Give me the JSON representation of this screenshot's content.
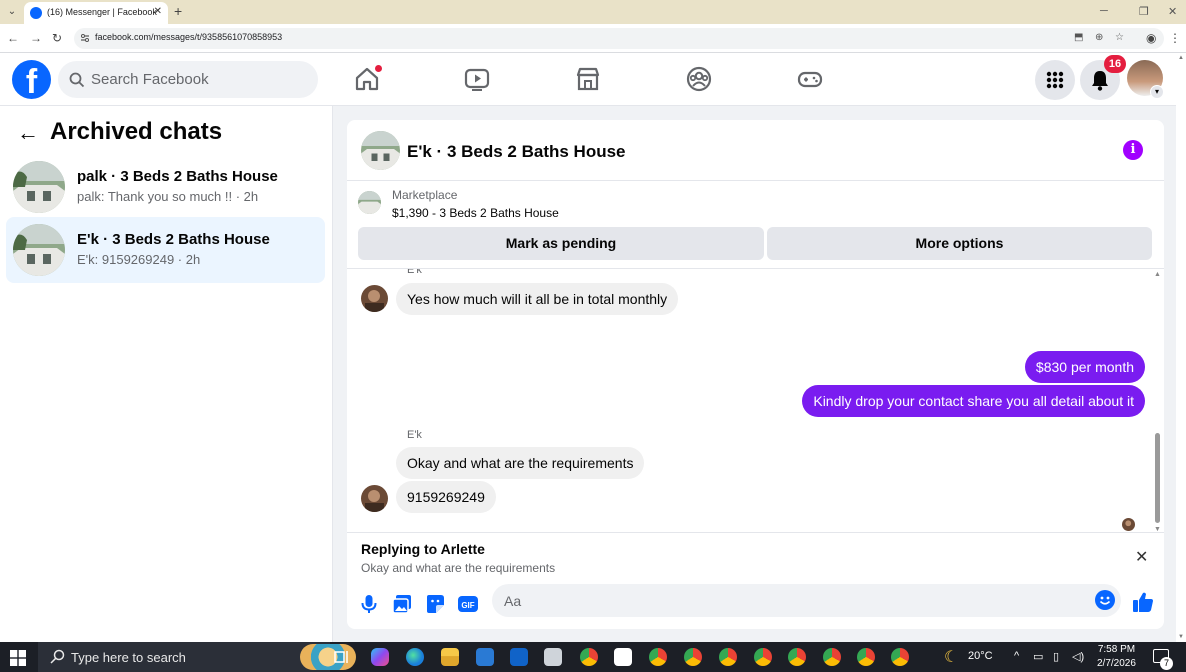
{
  "browser": {
    "tab_title": "(16) Messenger | Facebook",
    "url": "facebook.com/messages/t/9358561070858953"
  },
  "fb_header": {
    "search_placeholder": "Search Facebook",
    "notification_count": "16"
  },
  "sidebar": {
    "title": "Archived chats",
    "chats": [
      {
        "name": "palk · 3 Beds 2 Baths House",
        "snippet": "palk: Thank you so much !! · 2h",
        "active": false
      },
      {
        "name": "E'k · 3 Beds 2 Baths House",
        "snippet": "E'k: 9159269249 · 2h",
        "active": true
      }
    ]
  },
  "conversation": {
    "title": "E'k · 3 Beds 2 Baths House",
    "marketplace_label": "Marketplace",
    "marketplace_detail": "$1,390 - 3 Beds 2 Baths House",
    "mark_pending_label": "Mark as pending",
    "more_options_label": "More options",
    "messages": [
      {
        "sender": "E'k",
        "text": "Yes how much will it all be in total monthly",
        "direction": "in"
      },
      {
        "text": "$830 per month",
        "direction": "out"
      },
      {
        "text": "Kindly drop your contact share you all detail about it",
        "direction": "out"
      },
      {
        "sender": "E'k",
        "text": "Okay and what are the requirements",
        "direction": "in"
      },
      {
        "text": "9159269249",
        "direction": "in"
      }
    ],
    "reply_title": "Replying to Arlette",
    "reply_text": "Okay and what are the requirements",
    "composer_placeholder": "Aa"
  },
  "colors": {
    "fb_blue": "#0866ff",
    "outgoing_bubble": "#7a1cf0",
    "active_chat_bg": "#ebf5ff",
    "info_purple": "#a100ff"
  },
  "taskbar": {
    "search_placeholder": "Type here to search",
    "temperature": "20°C",
    "time": "7:58 PM",
    "date": "2/7/2026",
    "notification_count": "7"
  }
}
